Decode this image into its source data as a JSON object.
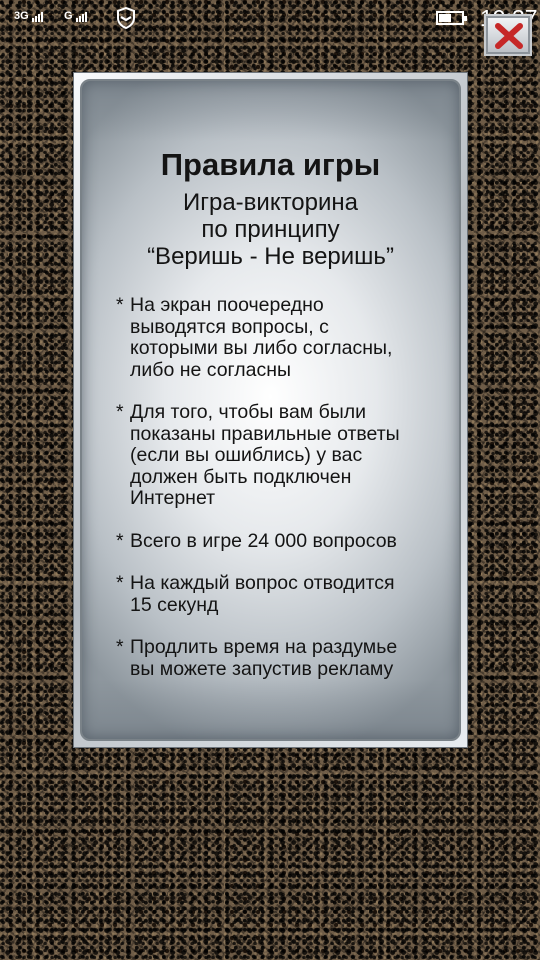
{
  "statusbar": {
    "sim1_label": "3G",
    "sim2_label": "G",
    "time": "19:37",
    "battery_level": 0.55
  },
  "icons": {
    "close": "close-x-icon",
    "shield": "shield-icon",
    "battery": "battery-icon",
    "signal": "signal-icon"
  },
  "rules_card": {
    "title": "Правила игры",
    "subtitle_lines": [
      "Игра-викторина",
      "по принципу",
      "“Веришь - Не веришь”"
    ],
    "items": [
      {
        "star": "*",
        "lines": [
          "На экран поочередно",
          "выводятся вопросы, с",
          "которыми вы либо согласны,",
          "либо не согласны"
        ]
      },
      {
        "star": "*",
        "lines": [
          "Для того, чтобы вам были",
          "показаны правильные ответы",
          "(если вы ошиблись) у вас",
          "должен быть подключен",
          "Интернет"
        ]
      },
      {
        "star": "*",
        "lines": [
          "Всего в игре 24 000 вопросов"
        ]
      },
      {
        "star": "*",
        "lines": [
          "На каждый вопрос отводится",
          "15 секунд"
        ]
      },
      {
        "star": "*",
        "lines": [
          "Продлить время на раздумье",
          "вы можете запустив рекламу"
        ]
      }
    ]
  },
  "colors": {
    "close_x": "#c62828",
    "text": "#141414",
    "background": "#5a4a38"
  }
}
